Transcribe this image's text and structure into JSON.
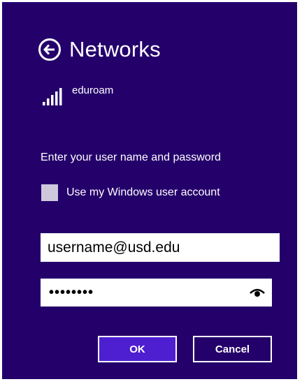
{
  "header": {
    "title": "Networks"
  },
  "network": {
    "name": "eduroam",
    "icon": "wifi-signal-icon"
  },
  "prompt": "Enter your user name and password",
  "use_windows_account": {
    "label": "Use my Windows user account",
    "checked": false
  },
  "username": {
    "value": "username@usd.edu"
  },
  "password": {
    "masked": "••••••••"
  },
  "buttons": {
    "ok": "OK",
    "cancel": "Cancel"
  },
  "colors": {
    "background": "#24006b",
    "ok_button": "#4e1fd1",
    "checkbox": "#cfc8dd"
  }
}
